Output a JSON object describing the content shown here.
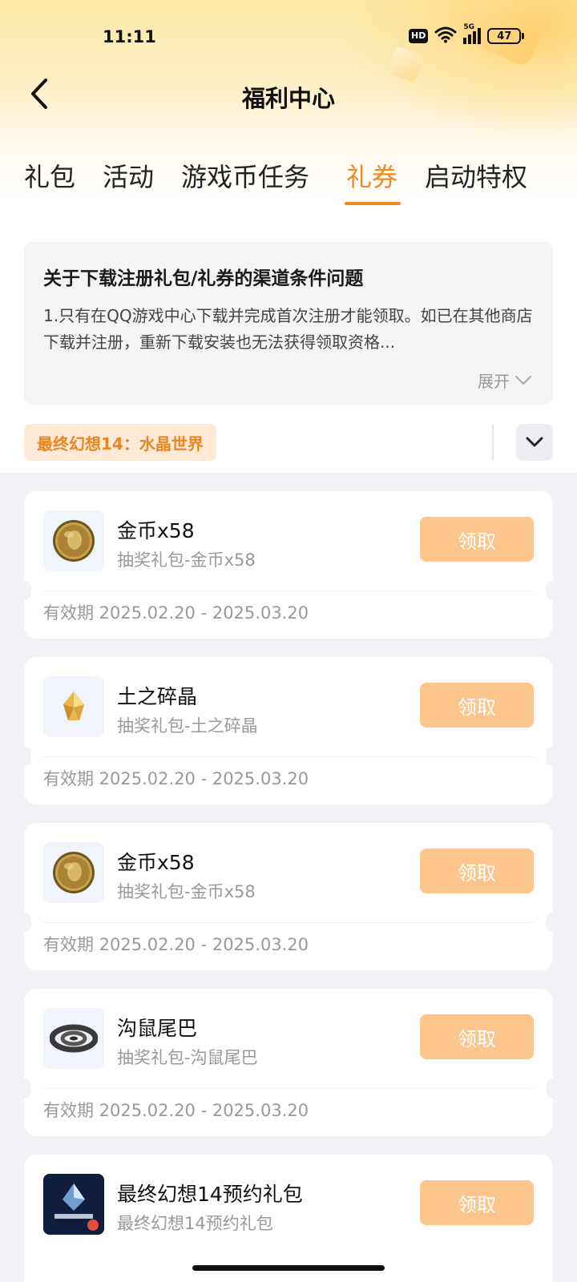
{
  "status_bar": {
    "time": "11:11",
    "hd": "HD",
    "network": "5G",
    "battery": "47"
  },
  "header": {
    "title": "福利中心"
  },
  "tabs": [
    {
      "label": "礼包",
      "active": false
    },
    {
      "label": "活动",
      "active": false
    },
    {
      "label": "游戏币任务",
      "active": false
    },
    {
      "label": "礼券",
      "active": true
    },
    {
      "label": "启动特权",
      "active": false
    }
  ],
  "notice": {
    "title": "关于下载注册礼包/礼券的渠道条件问题",
    "body": "1.只有在QQ游戏中心下载并完成首次注册才能领取。如已在其他商店下载并注册，重新下载安装也无法获得领取资格...",
    "expand_label": "展开"
  },
  "game_filter": {
    "selected": "最终幻想14：水晶世界"
  },
  "colors": {
    "accent": "#f08a1c",
    "claim_button": "#fbc58c",
    "tag_bg": "#fde9d6"
  },
  "coupons": [
    {
      "name": "金币x58",
      "desc": "抽奖礼包-金币x58",
      "button": "领取",
      "validity": "有效期 2025.02.20 - 2025.03.20",
      "icon": "gold-coin-icon"
    },
    {
      "name": "土之碎晶",
      "desc": "抽奖礼包-土之碎晶",
      "button": "领取",
      "validity": "有效期 2025.02.20 - 2025.03.20",
      "icon": "earth-shard-icon"
    },
    {
      "name": "金币x58",
      "desc": "抽奖礼包-金币x58",
      "button": "领取",
      "validity": "有效期 2025.02.20 - 2025.03.20",
      "icon": "gold-coin-icon"
    },
    {
      "name": "沟鼠尾巴",
      "desc": "抽奖礼包-沟鼠尾巴",
      "button": "领取",
      "validity": "有效期 2025.02.20 - 2025.03.20",
      "icon": "rat-tail-icon"
    },
    {
      "name": "最终幻想14预约礼包",
      "desc": "最终幻想14预约礼包",
      "button": "领取",
      "validity": "",
      "icon": "game-logo-icon"
    }
  ]
}
